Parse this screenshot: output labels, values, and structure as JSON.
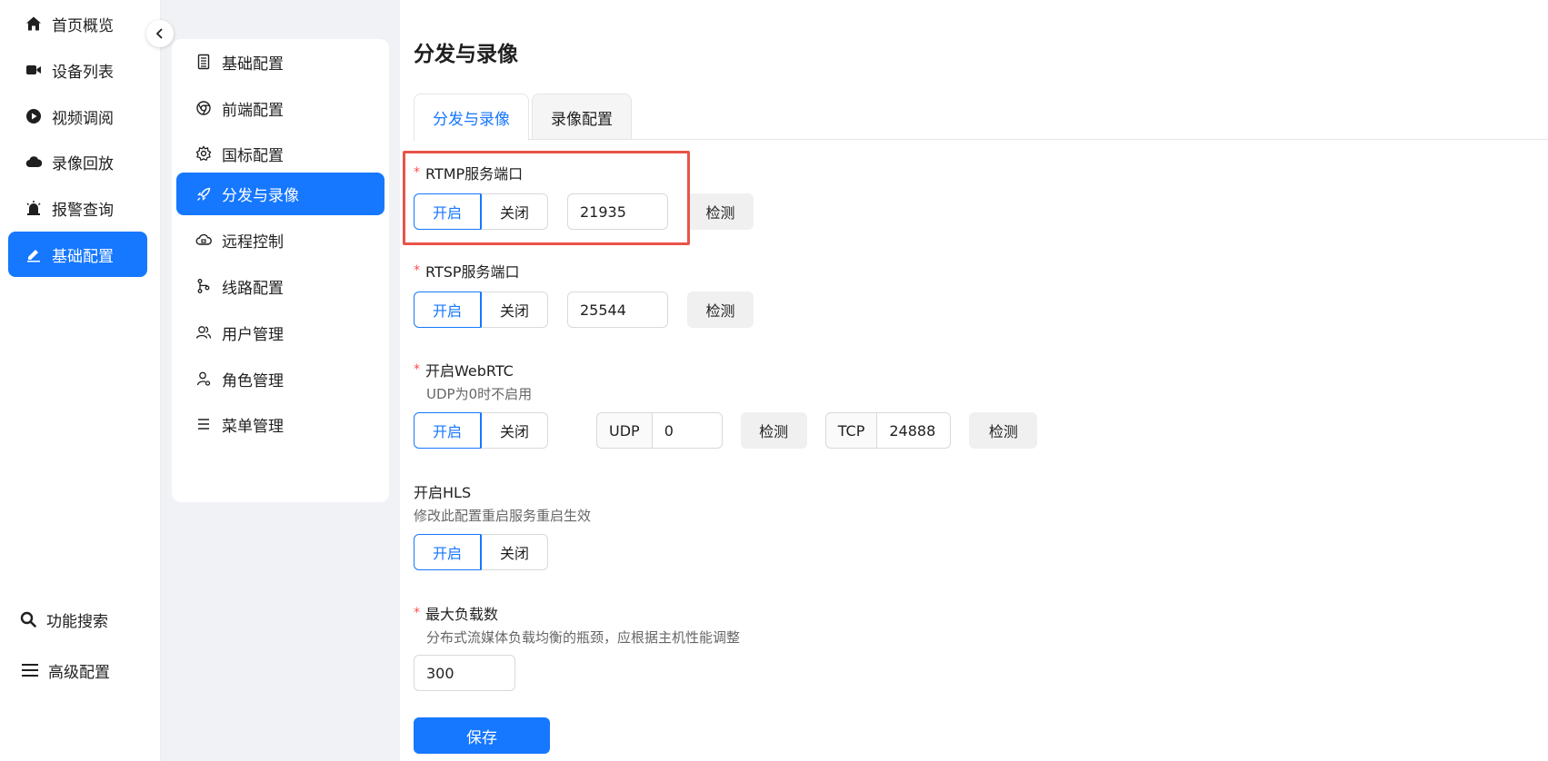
{
  "nav": {
    "items": [
      {
        "label": "首页概览",
        "icon": "home-icon"
      },
      {
        "label": "设备列表",
        "icon": "video-camera-icon"
      },
      {
        "label": "视频调阅",
        "icon": "play-circle-icon"
      },
      {
        "label": "录像回放",
        "icon": "cloud-icon"
      },
      {
        "label": "报警查询",
        "icon": "alarm-icon"
      },
      {
        "label": "基础配置",
        "icon": "edit-icon"
      }
    ],
    "bottom": [
      {
        "label": "功能搜索",
        "icon": "search-icon"
      },
      {
        "label": "高级配置",
        "icon": "menu-icon"
      }
    ]
  },
  "submenu": {
    "items": [
      {
        "label": "基础配置",
        "icon": "document-icon"
      },
      {
        "label": "前端配置",
        "icon": "chrome-icon"
      },
      {
        "label": "国标配置",
        "icon": "gear-icon"
      },
      {
        "label": "分发与录像",
        "icon": "rocket-icon"
      },
      {
        "label": "远程控制",
        "icon": "cloud-control-icon"
      },
      {
        "label": "线路配置",
        "icon": "branch-icon"
      },
      {
        "label": "用户管理",
        "icon": "users-icon"
      },
      {
        "label": "角色管理",
        "icon": "user-role-icon"
      },
      {
        "label": "菜单管理",
        "icon": "list-icon"
      }
    ]
  },
  "main": {
    "title": "分发与录像",
    "tabs": [
      "分发与录像",
      "录像配置"
    ],
    "rtmp": {
      "label": "RTMP服务端口",
      "on": "开启",
      "off": "关闭",
      "port": "21935",
      "check": "检测"
    },
    "rtsp": {
      "label": "RTSP服务端口",
      "on": "开启",
      "off": "关闭",
      "port": "25544",
      "check": "检测"
    },
    "webrtc": {
      "label": "开启WebRTC",
      "hint": "UDP为0时不启用",
      "on": "开启",
      "off": "关闭",
      "udp_label": "UDP",
      "udp_value": "0",
      "tcp_label": "TCP",
      "tcp_value": "24888",
      "check": "检测"
    },
    "hls": {
      "label": "开启HLS",
      "hint": "修改此配置重启服务重启生效",
      "on": "开启",
      "off": "关闭"
    },
    "max_load": {
      "label": "最大负载数",
      "hint": "分布式流媒体负载均衡的瓶颈，应根据主机性能调整",
      "value": "300"
    },
    "save": "保存"
  },
  "colors": {
    "accent": "#1677ff",
    "highlight": "#e8534a",
    "required": "#ff4d4f"
  }
}
